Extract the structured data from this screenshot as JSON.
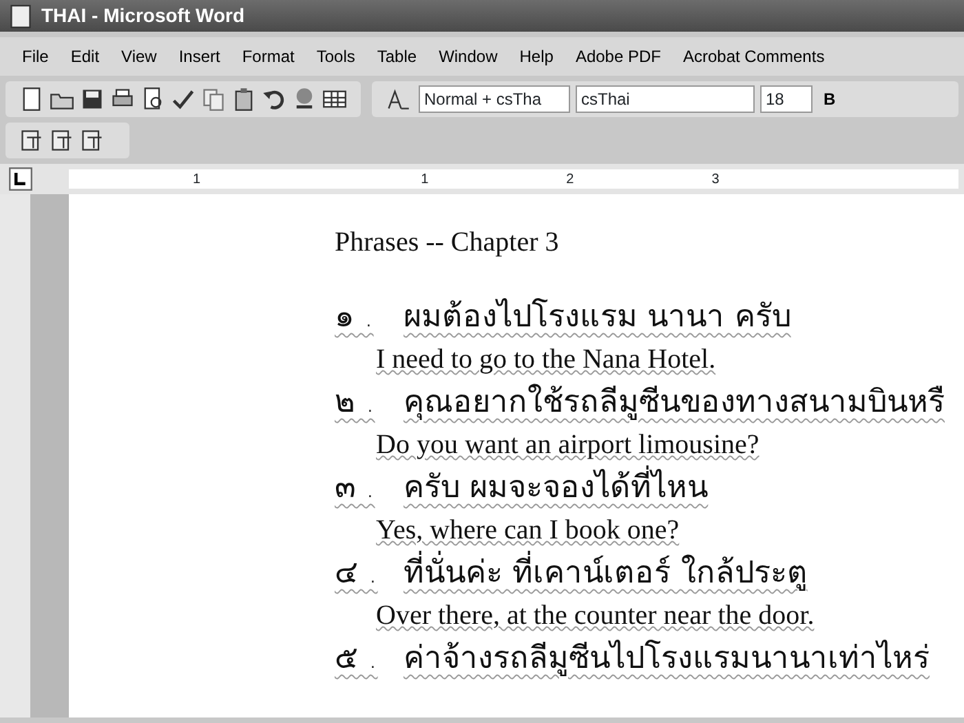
{
  "window": {
    "title": "THAI - Microsoft Word"
  },
  "menu": [
    {
      "label": "File"
    },
    {
      "label": "Edit"
    },
    {
      "label": "View"
    },
    {
      "label": "Insert"
    },
    {
      "label": "Format"
    },
    {
      "label": "Tools"
    },
    {
      "label": "Table"
    },
    {
      "label": "Window"
    },
    {
      "label": "Help"
    },
    {
      "label": "Adobe PDF"
    },
    {
      "label": "Acrobat Comments"
    }
  ],
  "formatting": {
    "style": "Normal + csTha",
    "font": "csThai",
    "size": "18",
    "bold": "B"
  },
  "ruler": {
    "labels": [
      "1",
      "1",
      "2",
      "3"
    ]
  },
  "document": {
    "heading": "Phrases -- Chapter 3",
    "phrases": [
      {
        "number": "๑ .",
        "thai": "ผมต้องไปโรงแรม นานา ครับ",
        "english": "I need to go to the Nana Hotel."
      },
      {
        "number": "๒ .",
        "thai": "คุณอยากใช้รถลีมูซีนของทางสนามบินหรื",
        "english": "Do you want an airport limousine?"
      },
      {
        "number": "๓ .",
        "thai": "ครับ ผมจะจองได้ที่ไหน",
        "english": "Yes, where can I book one?"
      },
      {
        "number": "๔ .",
        "thai": "ที่นั่นค่ะ ที่เคาน์เตอร์ ใกล้ประตู",
        "english": "Over there, at the counter near the door."
      },
      {
        "number": "๕ .",
        "thai": "ค่าจ้างรถลีมูซีนไปโรงแรมนานาเท่าไหร่"
      }
    ]
  }
}
